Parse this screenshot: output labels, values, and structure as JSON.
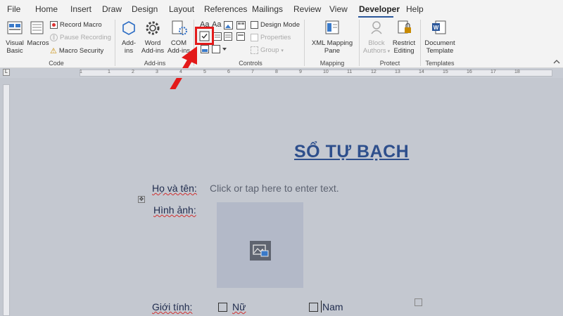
{
  "tabs": [
    "File",
    "Home",
    "Insert",
    "Draw",
    "Design",
    "Layout",
    "References",
    "Mailings",
    "Review",
    "View",
    "Developer",
    "Help"
  ],
  "active_tab": "Developer",
  "ribbon": {
    "code": {
      "label": "Code",
      "visual_basic": "Visual Basic",
      "visual_basic_1": "Visual",
      "visual_basic_2": "Basic",
      "macros": "Macros",
      "record_macro": "Record Macro",
      "pause_recording": "Pause Recording",
      "macro_security": "Macro Security"
    },
    "addins": {
      "label": "Add-ins",
      "addins_1": "Add-",
      "addins_2": "ins",
      "word_1": "Word",
      "word_2": "Add-ins",
      "com_1": "COM",
      "com_2": "Add-ins"
    },
    "controls": {
      "label": "Controls",
      "aa1": "Aa",
      "aa2": "Aa",
      "design_mode": "Design Mode",
      "properties": "Properties",
      "group": "Group"
    },
    "mapping": {
      "label": "Mapping",
      "xml_1": "XML Mapping",
      "xml_2": "Pane"
    },
    "protect": {
      "label": "Protect",
      "block_1": "Block",
      "block_2": "Authors",
      "restrict_1": "Restrict",
      "restrict_2": "Editing"
    },
    "templates": {
      "label": "Templates",
      "doc_1": "Document",
      "doc_2": "Template"
    }
  },
  "document": {
    "title": "SỔ TỰ BẠCH",
    "name_label": "Họ và tên:",
    "name_placeholder": "Click or tap here to enter text.",
    "image_label": "Hình ảnh:",
    "gender_label": "Giới tính:",
    "female": "Nữ",
    "male": "Nam"
  },
  "ruler": {
    "numbers": [
      "1",
      "1",
      "2",
      "3",
      "4",
      "5",
      "6",
      "7",
      "8",
      "9",
      "10",
      "11",
      "12",
      "13",
      "14",
      "15",
      "16",
      "17",
      "18"
    ]
  },
  "colors": {
    "annotation": "#e31a1a",
    "title": "#2e4f8c",
    "accent": "#2b579a"
  },
  "icons": {
    "checkbox_control": "checkbox-content-control-icon",
    "arrow": "red-arrow-annotation"
  }
}
